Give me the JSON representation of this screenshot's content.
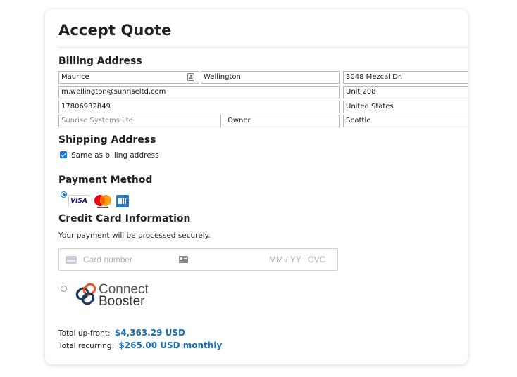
{
  "page": {
    "title": "Accept Quote"
  },
  "billing": {
    "heading": "Billing Address",
    "first_name": "Maurice",
    "last_name": "Wellington",
    "email": "m.wellington@sunriseltd.com",
    "phone": "17806932849",
    "company_placeholder": "Sunrise Systems Ltd",
    "title": "Owner",
    "address1": "3048 Mezcal Dr.",
    "address2": "Unit 208",
    "country": "United States",
    "city": "Seattle"
  },
  "shipping": {
    "heading": "Shipping Address",
    "same_as_billing_label": "Same as billing address",
    "same_as_billing_checked": true
  },
  "payment": {
    "heading": "Payment Method",
    "card_option_selected": true,
    "card_brands": [
      "VISA",
      "Mastercard",
      "American Express"
    ],
    "visa_label": "VISA",
    "connect_booster": {
      "line1": "Connect",
      "line2": "Booster",
      "selected": false
    },
    "colors": {
      "accent": "#1a73e8",
      "total": "#1a6fb0",
      "cb_orange": "#e8562a",
      "cb_navy": "#1f3a5f"
    }
  },
  "credit_card": {
    "heading": "Credit Card Information",
    "subtitle": "Your payment will be processed securely.",
    "number_placeholder": "Card number",
    "expiry_placeholder": "MM / YY",
    "cvc_placeholder": "CVC"
  },
  "totals": {
    "upfront_label": "Total up-front:",
    "upfront_amount": "$4,363.29 USD",
    "recurring_label": "Total recurring:",
    "recurring_amount": "$265.00 USD monthly"
  }
}
